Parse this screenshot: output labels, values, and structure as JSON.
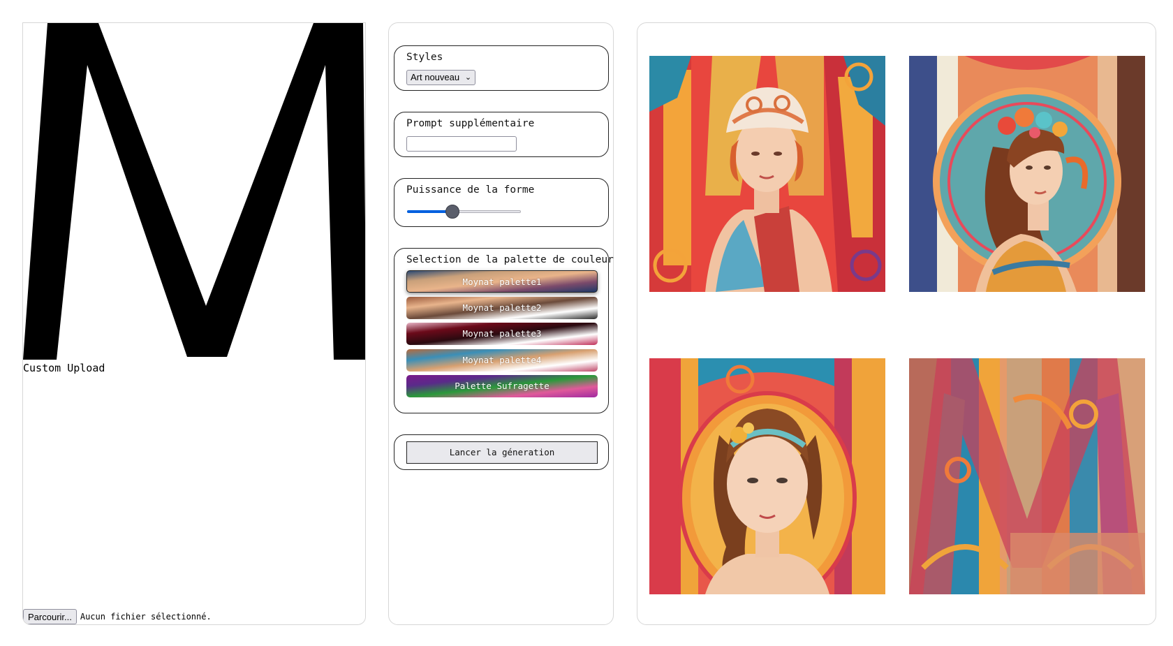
{
  "left": {
    "shape_letter": "M",
    "custom_upload_label": "Custom Upload",
    "browse_button": "Parcourir...",
    "file_status": "Aucun fichier sélectionné."
  },
  "controls": {
    "styles": {
      "title": "Styles",
      "selected": "Art nouveau"
    },
    "prompt": {
      "title": "Prompt supplémentaire",
      "value": "",
      "placeholder": ""
    },
    "force": {
      "title": "Puissance de la forme",
      "value_fraction": 0.4
    },
    "palettes": {
      "title": "Selection de la palette de couleur",
      "items": [
        {
          "label": "Moynat palette1",
          "selected": true,
          "colors": [
            "#2d4a73",
            "#c9a07a",
            "#e9b48a",
            "#7b4a6b",
            "#1f3a68"
          ]
        },
        {
          "label": "Moynat palette2",
          "selected": false,
          "colors": [
            "#9a5a3c",
            "#e8b48c",
            "#6b4a3a",
            "#ffffff",
            "#2a2a2a"
          ]
        },
        {
          "label": "Moynat palette3",
          "selected": false,
          "colors": [
            "#e8b6c8",
            "#6b0a1a",
            "#2a0a10",
            "#ffffff",
            "#c0305a"
          ]
        },
        {
          "label": "Moynat palette4",
          "selected": false,
          "colors": [
            "#b86a3c",
            "#3a8fb8",
            "#d8a070",
            "#ffffff",
            "#c04a6a"
          ]
        },
        {
          "label": "Palette Sufragette",
          "selected": false,
          "colors": [
            "#7a1a8a",
            "#5a2a8a",
            "#2a9a3a",
            "#e05a9a",
            "#a02aa0"
          ]
        }
      ]
    },
    "generate_button": "Lancer la géneration"
  },
  "results": {
    "images": [
      {
        "name": "result-image-1",
        "description_icon": "art-nouveau-woman-turban"
      },
      {
        "name": "result-image-2",
        "description_icon": "art-nouveau-woman-floral-crown"
      },
      {
        "name": "result-image-3",
        "description_icon": "art-nouveau-girl-headband"
      },
      {
        "name": "result-image-4",
        "description_icon": "art-nouveau-abstract-m"
      }
    ]
  }
}
